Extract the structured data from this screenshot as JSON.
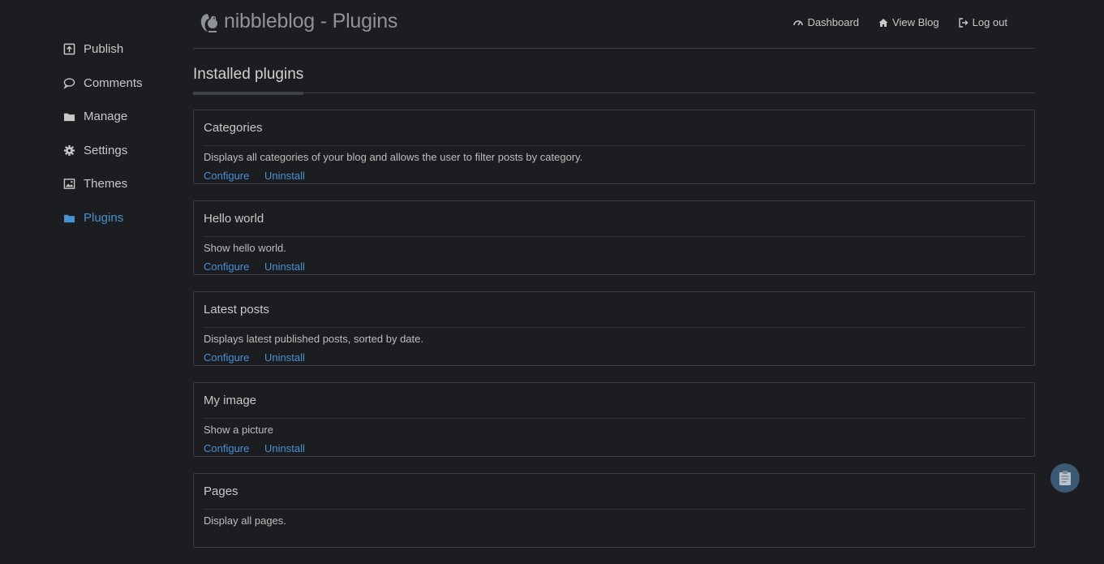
{
  "sidebar": {
    "items": [
      {
        "label": "Publish",
        "icon": "publish-icon"
      },
      {
        "label": "Comments",
        "icon": "comment-icon"
      },
      {
        "label": "Manage",
        "icon": "folder-icon"
      },
      {
        "label": "Settings",
        "icon": "gear-icon"
      },
      {
        "label": "Themes",
        "icon": "image-icon"
      },
      {
        "label": "Plugins",
        "icon": "folder-icon",
        "active": true
      }
    ]
  },
  "header": {
    "title": "nibbleblog - Plugins",
    "nav": [
      {
        "label": "Dashboard",
        "icon": "dashboard-icon"
      },
      {
        "label": "View Blog",
        "icon": "home-icon"
      },
      {
        "label": "Log out",
        "icon": "logout-icon"
      }
    ]
  },
  "main": {
    "section_title": "Installed plugins",
    "configure_label": "Configure",
    "uninstall_label": "Uninstall",
    "plugins": [
      {
        "name": "Categories",
        "description": "Displays all categories of your blog and allows the user to filter posts by category."
      },
      {
        "name": "Hello world",
        "description": "Show hello world."
      },
      {
        "name": "Latest posts",
        "description": "Displays latest published posts, sorted by date."
      },
      {
        "name": "My image",
        "description": "Show a picture"
      },
      {
        "name": "Pages",
        "description": "Display all pages."
      }
    ]
  },
  "colors": {
    "background": "#1b1d20",
    "accent": "#4a90d0",
    "border": "#3a3d41"
  }
}
